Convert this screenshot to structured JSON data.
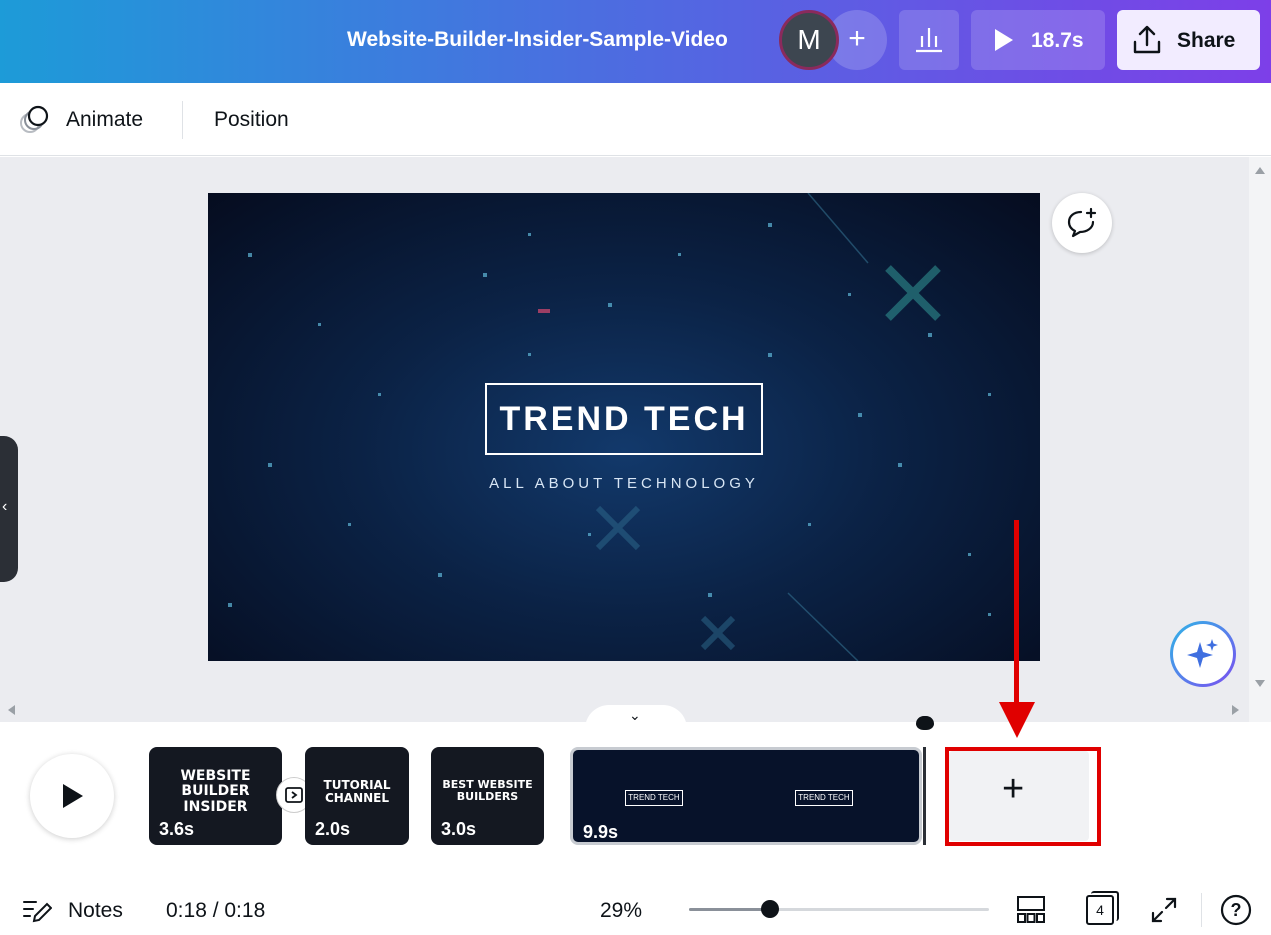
{
  "header": {
    "doc_title": "Website-Builder-Insider-Sample-Video",
    "avatar_initial": "M",
    "add_collaborator": "+",
    "present_duration": "18.7s",
    "share_label": "Share"
  },
  "toolbar": {
    "animate_label": "Animate",
    "position_label": "Position"
  },
  "slide": {
    "title": "TREND TECH",
    "subtitle": "ALL ABOUT TECHNOLOGY"
  },
  "timeline": {
    "clips": [
      {
        "text": "WEBSITE BUILDER INSIDER",
        "duration": "3.6s"
      },
      {
        "text": "TUTORIAL CHANNEL",
        "duration": "2.0s"
      },
      {
        "text": "BEST WEBSITE BUILDERS",
        "duration": "3.0s"
      },
      {
        "text": "TREND TECH",
        "duration": "9.9s"
      }
    ],
    "add_page": "+"
  },
  "footer": {
    "notes_label": "Notes",
    "time": "0:18 / 0:18",
    "zoom": "29%",
    "zoom_level_fraction": 0.27,
    "page_count": "4",
    "help": "?"
  },
  "colors": {
    "header_gradient_start": "#1d9bd8",
    "header_gradient_end": "#7d3fe8",
    "annotation_red": "#e00000"
  }
}
